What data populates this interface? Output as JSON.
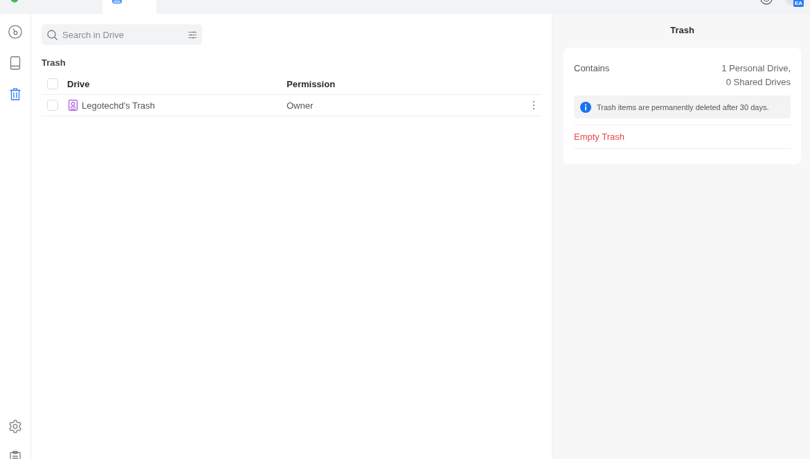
{
  "top_bar": {
    "tabs": [
      {
        "kind": "dot",
        "selected": false
      },
      {
        "kind": "drive",
        "selected": true
      }
    ],
    "avatar_badge": "EA"
  },
  "rail": {
    "items": [
      {
        "kind": "disc",
        "selected": false
      },
      {
        "kind": "drive",
        "selected": false
      },
      {
        "kind": "trash",
        "selected": true
      }
    ],
    "bottom_items": [
      {
        "kind": "settings",
        "selected": false
      },
      {
        "kind": "list",
        "selected": false
      }
    ]
  },
  "search": {
    "placeholder": "Search in Drive"
  },
  "section_title": "Trash",
  "table": {
    "columns": [
      "Drive",
      "Permission"
    ],
    "header_checked": false,
    "rows": [
      {
        "name": "Legotechd's Trash",
        "permission": "Owner",
        "checked": false
      }
    ]
  },
  "details": {
    "title": "Trash",
    "contains_label": "Contains",
    "contains_value": "1 Personal Drive, 0 Shared Drives",
    "notice": "Trash items are permanently deleted after 30 days.",
    "action": "Empty Trash"
  }
}
